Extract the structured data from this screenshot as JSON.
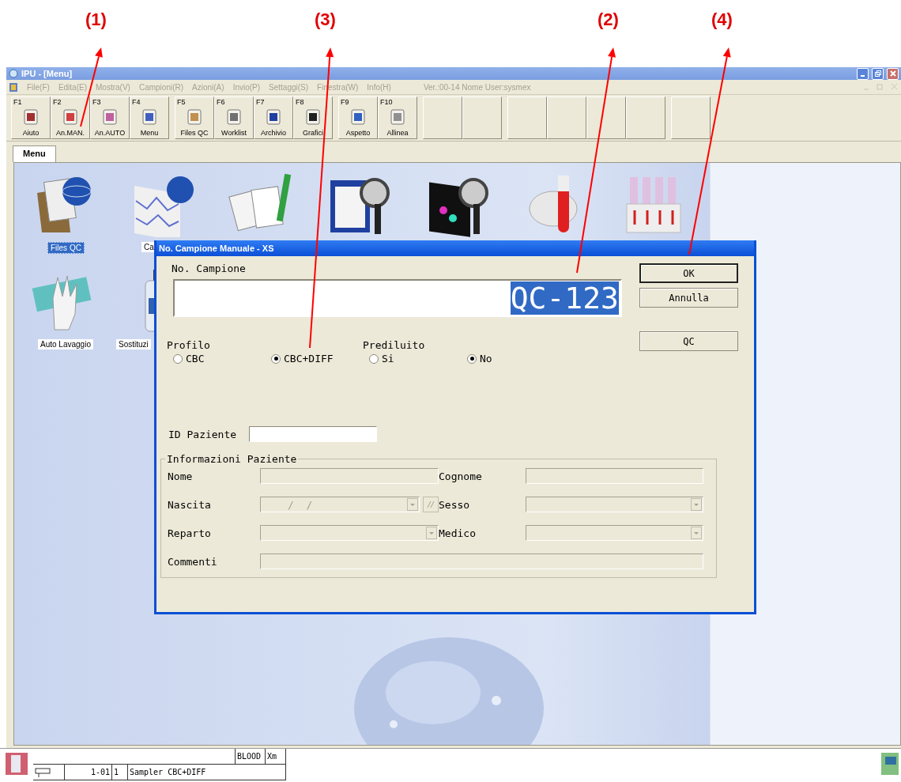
{
  "annotations": [
    {
      "label": "(1)"
    },
    {
      "label": "(3)"
    },
    {
      "label": "(2)"
    },
    {
      "label": "(4)"
    }
  ],
  "window": {
    "title": "IPU - [Menu]"
  },
  "menu": {
    "items": [
      {
        "label": "File(F)",
        "disabled": true
      },
      {
        "label": "Edita(E)",
        "disabled": true
      },
      {
        "label": "Mostra(V)",
        "disabled": true
      },
      {
        "label": "Campioni(R)",
        "disabled": true
      },
      {
        "label": "Azioni(A)",
        "disabled": true
      },
      {
        "label": "Invio(P)",
        "disabled": true
      },
      {
        "label": "Settaggi(S)",
        "disabled": true
      },
      {
        "label": "Finestra(W)",
        "disabled": true
      },
      {
        "label": "Info(H)",
        "disabled": true
      }
    ],
    "version": "Ver.:00-14 Nome User:sysmex"
  },
  "toolbar": {
    "groups": [
      [
        {
          "kind": "function",
          "key": "F1",
          "label": "Aiuto"
        },
        {
          "kind": "function",
          "key": "F2",
          "label": "An.MAN."
        },
        {
          "kind": "function",
          "key": "F3",
          "label": "An.AUTO"
        },
        {
          "kind": "function",
          "key": "F4",
          "label": "Menu"
        }
      ],
      [
        {
          "kind": "function",
          "key": "F5",
          "label": "Files QC"
        },
        {
          "kind": "function",
          "key": "F6",
          "label": "Worklist"
        },
        {
          "kind": "function",
          "key": "F7",
          "label": "Archivio"
        },
        {
          "kind": "function",
          "key": "F8",
          "label": "Grafici"
        }
      ],
      [
        {
          "kind": "function",
          "key": "F9",
          "label": "Aspetto"
        },
        {
          "kind": "function",
          "key": "F10",
          "label": "Allinea"
        }
      ],
      [
        {
          "kind": "blank"
        },
        {
          "kind": "blank"
        }
      ],
      [
        {
          "kind": "blank"
        },
        {
          "kind": "blank"
        },
        {
          "kind": "blank"
        },
        {
          "kind": "blank"
        }
      ],
      [
        {
          "kind": "blank"
        }
      ]
    ]
  },
  "tabs": [
    {
      "label": "Menu",
      "selected": true
    }
  ],
  "desktop": {
    "icons": [
      {
        "kind": "folder",
        "label": "Files QC",
        "selected": true
      },
      {
        "kind": "chart",
        "label": "Ca",
        "selected": false
      },
      {
        "kind": "documents"
      },
      {
        "kind": "clipboard"
      },
      {
        "kind": "scan"
      },
      {
        "kind": "tube"
      },
      {
        "kind": "rack"
      },
      {
        "kind": "glove",
        "label": "Auto Lavaggio",
        "selected": false
      },
      {
        "kind": "bottle",
        "label": "Sostituzi",
        "selected": false
      }
    ]
  },
  "dialog": {
    "title": "No. Campione Manuale - XS",
    "sample_label": "No. Campione",
    "sample_value": "QC-123",
    "buttons": [
      {
        "label": "OK",
        "default": true
      },
      {
        "label": "Annulla",
        "default": false
      }
    ],
    "extra_buttons": [
      {
        "label": "QC",
        "default": false
      }
    ],
    "profile": {
      "label": "Profilo",
      "options": [
        {
          "label": "CBC",
          "selected": false
        },
        {
          "label": "CBC+DIFF",
          "selected": true
        }
      ]
    },
    "prediluted": {
      "label": "Prediluito",
      "options": [
        {
          "label": "Si",
          "selected": false
        },
        {
          "label": "No",
          "selected": true
        }
      ]
    },
    "patient_id": {
      "label": "ID Paziente"
    },
    "patient_info": {
      "title": "Informazioni Paziente",
      "fields": [
        {
          "kind": "text",
          "label": "Nome",
          "disabled": true
        },
        {
          "kind": "text",
          "label": "Cognome",
          "disabled": true
        },
        {
          "kind": "date",
          "label": "Nascita",
          "value": "/  /",
          "disabled": true
        },
        {
          "kind": "dropdown",
          "label": "Sesso",
          "disabled": true
        },
        {
          "kind": "dropdown",
          "label": "Reparto",
          "disabled": true
        },
        {
          "kind": "dropdown",
          "label": "Medico",
          "disabled": true
        },
        {
          "kind": "wide",
          "label": "Commenti",
          "disabled": true
        }
      ]
    }
  },
  "status_bar": {
    "cells": [
      "BLOOD",
      "Xm"
    ],
    "sample_no": "1-01",
    "rack": "1",
    "mode": "Sampler CBC+DIFF"
  }
}
